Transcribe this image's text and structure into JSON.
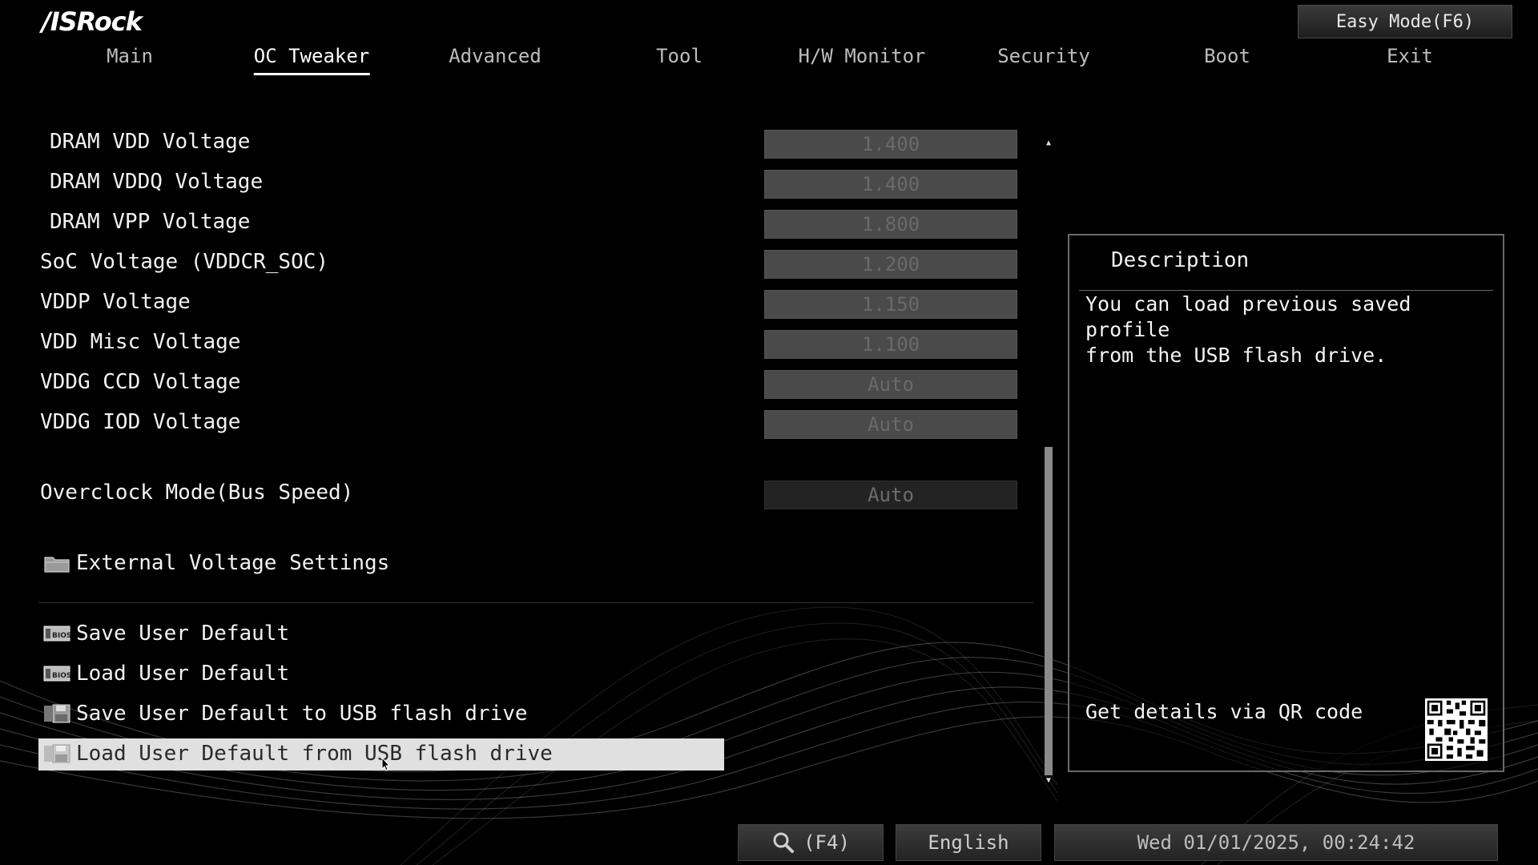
{
  "brand": {
    "logo_text": "/ISRock"
  },
  "header": {
    "easy_mode_label": "Easy Mode(F6)"
  },
  "tabs": [
    {
      "label": "Main",
      "active": false
    },
    {
      "label": "OC Tweaker",
      "active": true
    },
    {
      "label": "Advanced",
      "active": false
    },
    {
      "label": "Tool",
      "active": false
    },
    {
      "label": "H/W Monitor",
      "active": false
    },
    {
      "label": "Security",
      "active": false
    },
    {
      "label": "Boot",
      "active": false
    },
    {
      "label": "Exit",
      "active": false
    }
  ],
  "settings": [
    {
      "label": "DRAM VDD Voltage",
      "value": "1.400"
    },
    {
      "label": "DRAM VDDQ Voltage",
      "value": "1.400"
    },
    {
      "label": "DRAM VPP Voltage",
      "value": "1.800"
    },
    {
      "label": "SoC Voltage (VDDCR_SOC)",
      "value": "1.200"
    },
    {
      "label": "VDDP Voltage",
      "value": "1.150"
    },
    {
      "label": "VDD Misc Voltage",
      "value": "1.100"
    },
    {
      "label": "VDDG CCD Voltage",
      "value": "Auto"
    },
    {
      "label": "VDDG IOD Voltage",
      "value": "Auto"
    },
    {
      "label": "Overclock Mode(Bus Speed)",
      "value": "Auto"
    }
  ],
  "submenu": {
    "label": "External Voltage Settings",
    "icon": "folder-icon"
  },
  "actions": [
    {
      "label": "Save User Default",
      "icon": "bios-icon"
    },
    {
      "label": "Load User Default",
      "icon": "bios-icon"
    },
    {
      "label": "Save User Default to USB flash drive",
      "icon": "floppy-icon"
    },
    {
      "label": "Load User Default from USB flash drive",
      "icon": "floppy-icon",
      "selected": true
    }
  ],
  "description": {
    "title": "Description",
    "text": "You can load previous saved profile\nfrom the USB flash drive.",
    "qr_label": "Get details via QR code"
  },
  "footer": {
    "search_label": "(F4)",
    "language": "English",
    "datetime": "Wed 01/01/2025, 00:24:42"
  },
  "colors": {
    "background": "#000000",
    "selected_row": "#e0e0e0",
    "value_box": "#4a4a4a"
  }
}
